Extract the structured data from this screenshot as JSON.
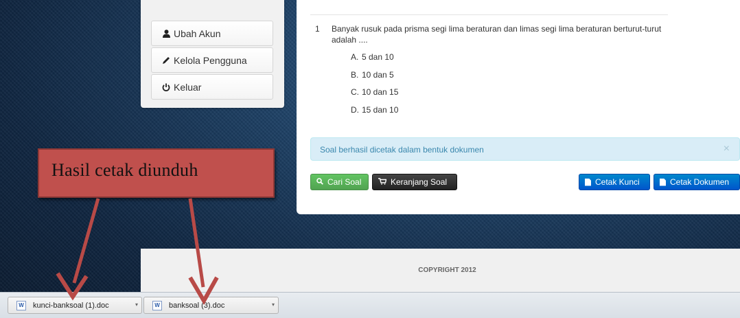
{
  "sidebar": {
    "items": [
      {
        "label": "Ubah Akun",
        "icon": "user-icon"
      },
      {
        "label": "Kelola Pengguna",
        "icon": "pencil-icon"
      },
      {
        "label": "Keluar",
        "icon": "power-icon"
      }
    ]
  },
  "question": {
    "number": "1",
    "text": "Banyak rusuk pada prisma segi lima beraturan dan limas segi lima beraturan berturut-turut adalah ....",
    "options": [
      {
        "label": "A.",
        "text": "5 dan 10"
      },
      {
        "label": "B.",
        "text": "10 dan 5"
      },
      {
        "label": "C.",
        "text": "10 dan 15"
      },
      {
        "label": "D.",
        "text": "15 dan 10"
      }
    ]
  },
  "alert": {
    "message": "Soal berhasil dicetak dalam bentuk dokumen",
    "close": "×"
  },
  "buttons": {
    "cari_soal": "Cari Soal",
    "keranjang_soal": "Keranjang Soal",
    "cetak_kunci": "Cetak Kunci",
    "cetak_dokumen": "Cetak Dokumen"
  },
  "footer": {
    "copyright": "COPYRIGHT 2012"
  },
  "downloads": [
    {
      "filename": "kunci-banksoal (1).doc",
      "icon": "word-doc-icon"
    },
    {
      "filename": "banksoal (3).doc",
      "icon": "word-doc-icon"
    }
  ],
  "annotation": {
    "text": "Hasil  cetak diunduh"
  },
  "colors": {
    "annotation_fill": "#c0504d",
    "arrow": "#c0504d",
    "alert_bg": "#d9edf7",
    "btn_green": "#51a351",
    "btn_blue": "#0055cc"
  }
}
